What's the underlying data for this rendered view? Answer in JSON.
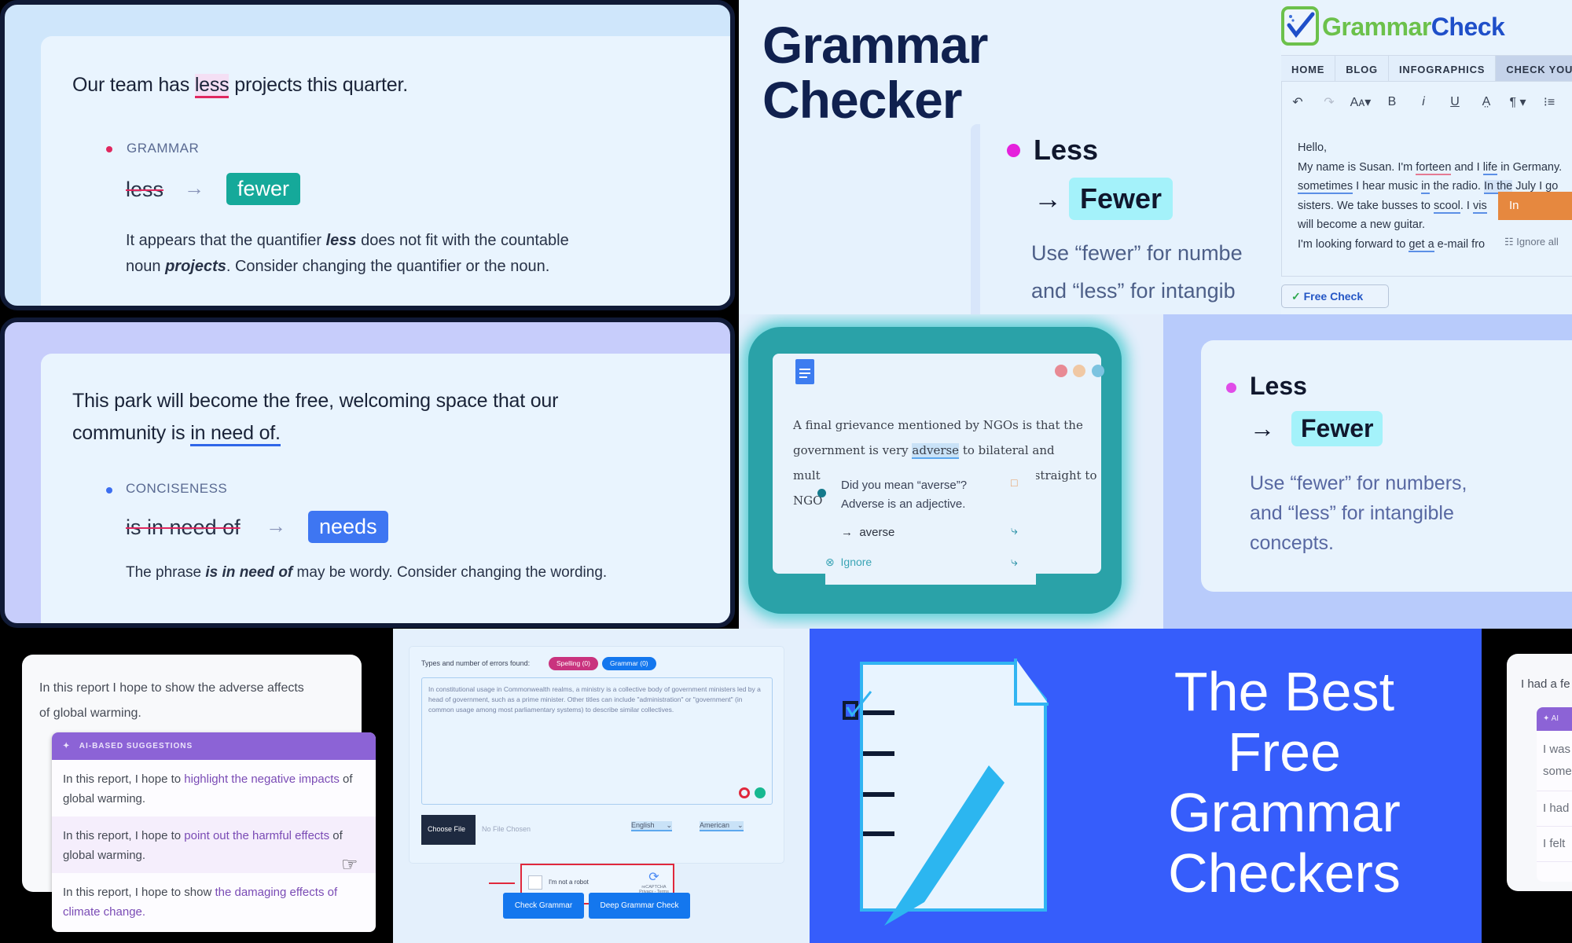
{
  "tile_grammar": {
    "sentence_before": "Our team has",
    "sentence_highlight": "less",
    "sentence_after": "projects this quarter.",
    "category": "GRAMMAR",
    "category_dot_color": "#e0275f",
    "original": "less",
    "arrow": "→",
    "replacement": "fewer",
    "replacement_color": "#15a99a",
    "explanation_1": "It appears that the quantifier",
    "explanation_bold_1": "less",
    "explanation_2": "does not fit with the countable",
    "explanation_3": "noun",
    "explanation_bold_2": "projects",
    "explanation_4": ". Consider changing the quantifier or the noun."
  },
  "tile_conciseness": {
    "sentence_line1": "This park will become the free, welcoming space that our",
    "sentence_line2_before": "community is",
    "sentence_highlight": "in need of.",
    "category": "CONCISENESS",
    "category_dot_color": "#3c6ef0",
    "original": "is in need of",
    "arrow": "→",
    "replacement": "needs",
    "replacement_color": "#3e76f2",
    "explanation_1": "The phrase",
    "explanation_bold": "is in need of",
    "explanation_2": "may be wordy. Consider changing the wording."
  },
  "tile_heading": {
    "title_line1": "Grammar",
    "title_line2": "Checker",
    "word": "Less",
    "arrow": "→",
    "replacement": "Fewer",
    "rule_line1": "Use “fewer” for numbe",
    "rule_line2": "and “less” for intangib"
  },
  "tile_website": {
    "logo_part1": "Grammar",
    "logo_part2": "Check",
    "logo_color1": "#6cc14b",
    "logo_color2": "#1f4fc9",
    "nav": [
      "HOME",
      "BLOG",
      "INFOGRAPHICS",
      "CHECK YOUR T"
    ],
    "toolbar": [
      "↶",
      "↷",
      "Aᴀ▾",
      "B",
      "i",
      "U",
      "A̤",
      "¶ ▾",
      "⁝≡"
    ],
    "lines": {
      "l1": "Hello,",
      "l2a": "My name is Susan. I'm ",
      "l2b": "forteen",
      "l2c": " and I ",
      "l2d": "life",
      "l2e": " in Germany.",
      "l3a": "sometimes",
      "l3b": " I hear music ",
      "l3c": "in",
      "l3d": " the radio. ",
      "l3e": "In the",
      "l3f": " July I go",
      "l4a": "sisters. We take busses to ",
      "l4b": "scool",
      "l4c": ". I ",
      "l4d": "vis",
      "l5": "will become a new guitar.",
      "l6a": "I'm looking forward to ",
      "l6b": "get a",
      "l6c": " e-mail fro"
    },
    "suggestion": "In",
    "ignore_all": "Ignore all",
    "free_check": "Free Check"
  },
  "tile_docs": {
    "line1": "A final grievance mentioned by NGOs is that the",
    "line2_before": "government is very",
    "line2_highlight": "adverse",
    "line2_after": "to bilateral and",
    "line3_start": "mult",
    "line3_end": "straight to",
    "line4_start": "NGO",
    "popup_title": "Did you mean “averse”?",
    "popup_detail": "Adverse is an adjective.",
    "suggestion": "averse",
    "ignore": "Ignore",
    "window_dots": [
      "#e88a94",
      "#f0c8a4",
      "#7cc3e0"
    ]
  },
  "tile_card": {
    "word": "Less",
    "arrow": "→",
    "replacement": "Fewer",
    "rule_line1": "Use “fewer” for numbers,",
    "rule_line2": "and “less” for intangible",
    "rule_line3": "concepts."
  },
  "tile_ai": {
    "source_line1": "In this report I hope to show the adverse affects",
    "source_line2": "of global warming.",
    "header": "AI-BASED SUGGESTIONS",
    "options": [
      {
        "a": "In this report, I hope to ",
        "b": "highlight the negative impacts",
        "c": " of global warming."
      },
      {
        "a": "In this report, I hope to ",
        "b": "point out the harmful effects",
        "c": " of global warming."
      },
      {
        "a": "In this report, I hope to show ",
        "b": "the damaging effects of climate change.",
        "c": ""
      }
    ]
  },
  "tile_form": {
    "types_label": "Types and number of errors found:",
    "spelling_chip": "Spelling (0)",
    "grammar_chip": "Grammar (0)",
    "spelling_color": "#c9337e",
    "grammar_color": "#1477ee",
    "textarea_text": "In constitutional usage in Commonwealth realms, a ministry is a collective body of government ministers led by a head of government, such as a prime minister. Other titles can include \"administration\" or \"government\" (in common usage among most parliamentary systems) to describe similar collectives.",
    "choose_file": "Choose File",
    "no_file": "No File Chosen",
    "language": "English",
    "dialect": "American",
    "captcha_label": "I'm not a robot",
    "captcha_brand": "reCAPTCHA",
    "captcha_links": "Privacy - Terms",
    "check_button": "Check Grammar",
    "deep_button": "Deep Grammar Check"
  },
  "tile_banner": {
    "line1": "The Best",
    "line2": "Free",
    "line3": "Grammar",
    "line4": "Checkers"
  },
  "tile_cutoff": {
    "line1": "I had a fe",
    "header": "AI",
    "rows": [
      "I was",
      "some",
      "I had",
      "I felt"
    ]
  }
}
